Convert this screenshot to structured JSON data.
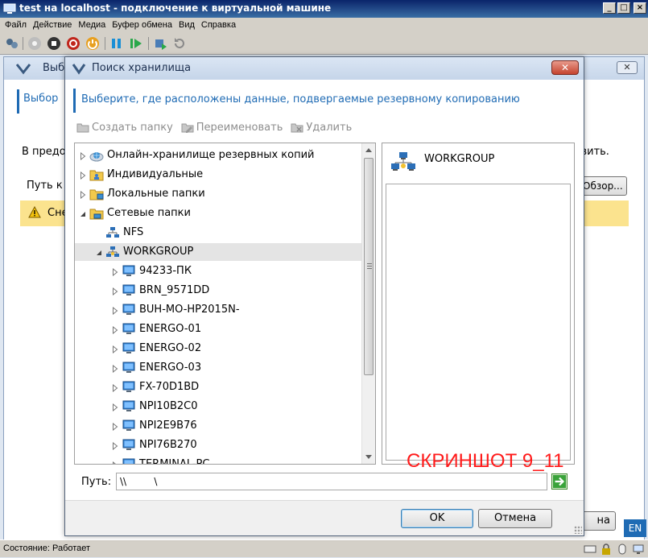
{
  "vm_window": {
    "title": "test на localhost - подключение к виртуальной машине",
    "caption_buttons": {
      "minimize": "_",
      "maximize": "□",
      "close": "×"
    },
    "menu": [
      "Файл",
      "Действие",
      "Медиа",
      "Буфер обмена",
      "Вид",
      "Справка"
    ],
    "toolbar_icons": [
      "ctrl-alt-del-icon",
      "start-icon",
      "turn-off-icon",
      "shutdown-icon",
      "power-icon",
      "pause-icon",
      "resume-icon",
      "snapshot-icon",
      "revert-icon"
    ]
  },
  "background_window": {
    "title_fragment": "Выбо",
    "section_fragment": "Выбор",
    "text_fragment_left": "В предо",
    "text_fragment_right": "новить.",
    "path_fragment": "Путь к",
    "browse_fragment": "Обзор...",
    "warning_fragment": "Сне",
    "footer_button_fragment": "на",
    "close_label": "✕"
  },
  "dialog": {
    "title": "Поиск хранилища",
    "close_label": "✕",
    "section_title": "Выберите, где расположены данные, подвергаемые резервному копированию",
    "toolbar": {
      "create_folder": "Создать папку",
      "rename": "Переименовать",
      "delete": "Удалить"
    },
    "tree": [
      {
        "label": "Онлайн-хранилище резервных копий",
        "icon": "cloud-storage-icon",
        "level": 0,
        "expander": "collapsed"
      },
      {
        "label": "Индивидуальные",
        "icon": "personal-folder-icon",
        "level": 0,
        "expander": "collapsed"
      },
      {
        "label": "Локальные папки",
        "icon": "local-folder-icon",
        "level": 0,
        "expander": "collapsed"
      },
      {
        "label": "Сетевые папки",
        "icon": "network-folder-icon",
        "level": 0,
        "expander": "expanded"
      },
      {
        "label": "NFS",
        "icon": "network-icon",
        "level": 1,
        "expander": "none"
      },
      {
        "label": "WORKGROUP",
        "icon": "workgroup-icon",
        "level": 1,
        "expander": "expanded",
        "selected": true
      },
      {
        "label": "94233-ПК",
        "icon": "computer-icon",
        "level": 2,
        "expander": "collapsed"
      },
      {
        "label": "BRN_9571DD",
        "icon": "computer-icon",
        "level": 2,
        "expander": "collapsed"
      },
      {
        "label": "BUH-MO-HP2015N-",
        "icon": "computer-icon",
        "level": 2,
        "expander": "collapsed"
      },
      {
        "label": "ENERGO-01",
        "icon": "computer-icon",
        "level": 2,
        "expander": "collapsed"
      },
      {
        "label": "ENERGO-02",
        "icon": "computer-icon",
        "level": 2,
        "expander": "collapsed"
      },
      {
        "label": "ENERGO-03",
        "icon": "computer-icon",
        "level": 2,
        "expander": "collapsed"
      },
      {
        "label": "FX-70D1BD",
        "icon": "computer-icon",
        "level": 2,
        "expander": "collapsed"
      },
      {
        "label": "NPI10B2C0",
        "icon": "computer-icon",
        "level": 2,
        "expander": "collapsed"
      },
      {
        "label": "NPI2E9B76",
        "icon": "computer-icon",
        "level": 2,
        "expander": "collapsed"
      },
      {
        "label": "NPI76B270",
        "icon": "computer-icon",
        "level": 2,
        "expander": "collapsed"
      },
      {
        "label": "TERMINAL-PC",
        "icon": "computer-icon",
        "level": 2,
        "expander": "collapsed"
      }
    ],
    "detail": {
      "title": "WORKGROUP",
      "icon": "workgroup-icon"
    },
    "path": {
      "label": "Путь:",
      "value": "\\\\         \\"
    },
    "buttons": {
      "ok": "OK",
      "cancel": "Отмена"
    }
  },
  "watermark": "СКРИНШОТ 9_11",
  "language_indicator": "EN",
  "statusbar": {
    "status": "Состояние: Работает"
  },
  "colors": {
    "accent_blue": "#1f6bb4",
    "warning_yellow": "#fbe38e",
    "watermark_red": "#ff1a1a",
    "title_gradient_start": "#0a246a"
  }
}
